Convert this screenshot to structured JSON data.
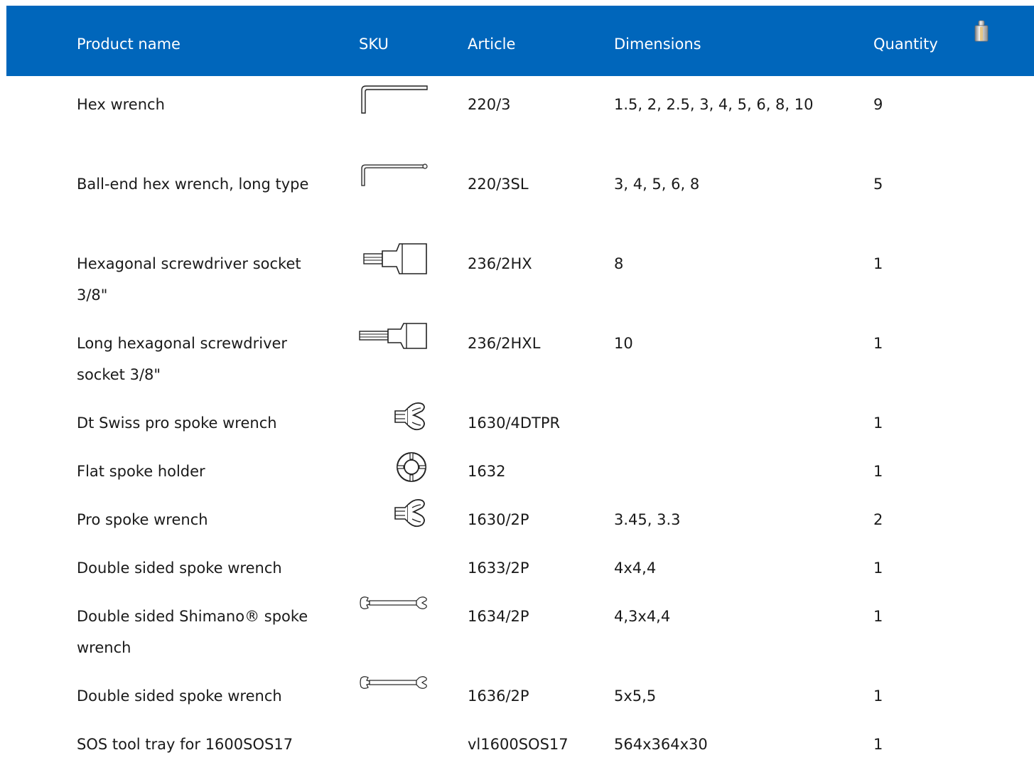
{
  "table": {
    "headers": {
      "name": "Product name",
      "sku": "SKU",
      "article": "Article",
      "dimensions": "Dimensions",
      "quantity": "Quantity",
      "weight_icon": "weight-icon"
    },
    "colors": {
      "header_bg": "#0066bb",
      "header_text": "#ffffff",
      "body_text": "#1a1a1a"
    },
    "rows": [
      {
        "name": "Hex wrench",
        "sku_icon": "hex-key-icon",
        "article": "220/3",
        "dimensions": "1.5, 2, 2.5, 3, 4, 5, 6, 8, 10",
        "quantity": "9"
      },
      {
        "name": "Ball-end hex wrench, long type",
        "sku_icon": "ball-end-hex-key-icon",
        "article": "220/3SL",
        "dimensions": "3, 4, 5, 6, 8",
        "quantity": "5"
      },
      {
        "name": "Hexagonal screwdriver socket 3/8\"",
        "sku_icon": "hex-socket-icon",
        "article": "236/2HX",
        "dimensions": "8",
        "quantity": "1"
      },
      {
        "name": "Long hexagonal screwdriver socket 3/8\"",
        "sku_icon": "long-hex-socket-icon",
        "article": "236/2HXL",
        "dimensions": "10",
        "quantity": "1"
      },
      {
        "name": "Dt Swiss pro spoke wrench",
        "sku_icon": "spoke-wrench-icon",
        "article": "1630/4DTPR",
        "dimensions": "",
        "quantity": "1"
      },
      {
        "name": "Flat spoke holder",
        "sku_icon": "spoke-holder-icon",
        "article": "1632",
        "dimensions": "",
        "quantity": "1"
      },
      {
        "name": "Pro spoke wrench",
        "sku_icon": "spoke-wrench-icon",
        "article": "1630/2P",
        "dimensions": "3.45, 3.3",
        "quantity": "2"
      },
      {
        "name": "Double sided spoke wrench",
        "sku_icon": "",
        "article": "1633/2P",
        "dimensions": "4x4,4",
        "quantity": "1"
      },
      {
        "name": "Double sided Shimano® spoke wrench",
        "sku_icon": "double-spoke-wrench-icon",
        "article": "1634/2P",
        "dimensions": "4,3x4,4",
        "quantity": "1"
      },
      {
        "name": "Double sided spoke wrench",
        "sku_icon": "double-spoke-wrench-icon",
        "article": "1636/2P",
        "dimensions": "5x5,5",
        "quantity": "1"
      },
      {
        "name": "SOS tool tray for 1600SOS17",
        "sku_icon": "",
        "article": "vl1600SOS17",
        "dimensions": "564x364x30",
        "quantity": "1"
      }
    ]
  }
}
